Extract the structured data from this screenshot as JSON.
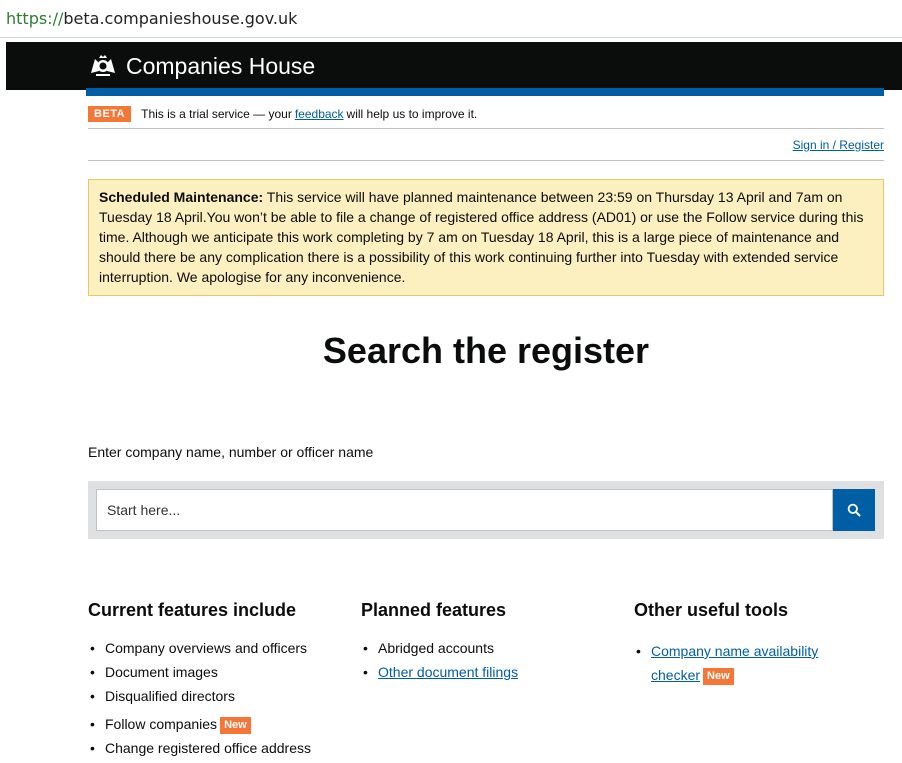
{
  "browser": {
    "url_protocol": "https://",
    "url_host": "beta.companieshouse.gov.uk"
  },
  "header": {
    "brand": "Companies House",
    "crest_icon": "royal-crest-icon"
  },
  "beta_banner": {
    "tag": "BETA",
    "text_before": "This is a trial service — your ",
    "link": "feedback",
    "text_after": " will help us to improve it."
  },
  "account": {
    "sign_in": "Sign in / Register"
  },
  "maintenance": {
    "heading": "Scheduled Maintenance:",
    "body": " This service will have planned maintenance between 23:59 on Thursday 13 April and 7am on Tuesday 18 April.You won’t be able to file a change of registered office address (AD01) or use the Follow service during this time. Although we anticipate this work completing by 7 am on Tuesday 18 April, this is a large piece of maintenance and should there be any complication there is a possibility of this work continuing further into Tuesday with extended service interruption. We apologise for any inconvenience."
  },
  "search": {
    "title": "Search the register",
    "label": "Enter company name, number or officer name",
    "placeholder": "Start here...",
    "button_icon": "search-icon"
  },
  "features": {
    "current": {
      "heading": "Current features include",
      "items": [
        "Company overviews and officers",
        "Document images",
        "Disqualified directors",
        "Follow companies",
        "Change registered office address"
      ],
      "new_badge": "New"
    },
    "planned": {
      "heading": "Planned features",
      "items": [
        "Abridged accounts",
        "Other document filings"
      ]
    },
    "tools": {
      "heading": "Other useful tools",
      "items": [
        "Company name availability checker"
      ],
      "new_badge": "New"
    }
  },
  "colors": {
    "header_bg": "#0b0c0c",
    "brand_blue": "#005ea5",
    "beta_orange": "#f47738",
    "maintenance_bg": "#fcefc0"
  }
}
